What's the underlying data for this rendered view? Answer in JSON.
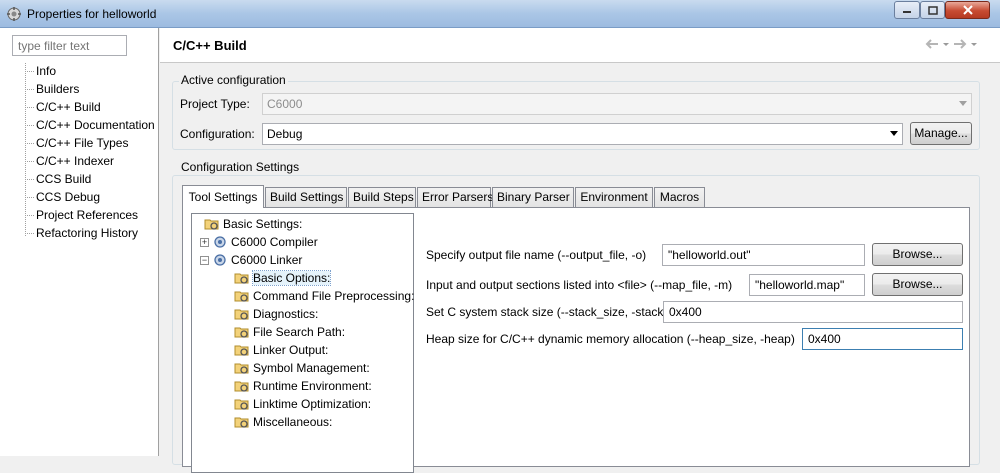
{
  "window": {
    "title": "Properties for helloworld"
  },
  "sidebar": {
    "filter_placeholder": "type filter text",
    "items": [
      {
        "label": "Info"
      },
      {
        "label": "Builders"
      },
      {
        "label": "C/C++ Build"
      },
      {
        "label": "C/C++ Documentation"
      },
      {
        "label": "C/C++ File Types"
      },
      {
        "label": "C/C++ Indexer"
      },
      {
        "label": "CCS Build"
      },
      {
        "label": "CCS Debug"
      },
      {
        "label": "Project References"
      },
      {
        "label": "Refactoring History"
      }
    ],
    "selected_index": 2
  },
  "header": {
    "title": "C/C++ Build",
    "back_icon": "back-arrow-icon",
    "forward_icon": "forward-arrow-icon"
  },
  "active_configuration": {
    "legend": "Active configuration",
    "project_type_label": "Project Type:",
    "project_type_value": "C6000",
    "configuration_label": "Configuration:",
    "configuration_value": "Debug",
    "manage_button": "Manage..."
  },
  "configuration_settings": {
    "legend": "Configuration Settings",
    "tabs": [
      {
        "label": "Tool Settings"
      },
      {
        "label": "Build Settings"
      },
      {
        "label": "Build Steps"
      },
      {
        "label": "Error Parsers"
      },
      {
        "label": "Binary Parser"
      },
      {
        "label": "Environment"
      },
      {
        "label": "Macros"
      }
    ],
    "active_tab_index": 0
  },
  "tool_tree": {
    "items": [
      {
        "label": "Basic Settings:",
        "icon": "settings-folder-icon"
      },
      {
        "label": "C6000 Compiler",
        "icon": "tool-gear-icon"
      },
      {
        "label": "C6000 Linker",
        "icon": "tool-gear-icon"
      },
      {
        "label": "Basic Options:",
        "icon": "settings-folder-icon"
      },
      {
        "label": "Command File Preprocessing:",
        "icon": "settings-folder-icon"
      },
      {
        "label": "Diagnostics:",
        "icon": "settings-folder-icon"
      },
      {
        "label": "File Search Path:",
        "icon": "settings-folder-icon"
      },
      {
        "label": "Linker Output:",
        "icon": "settings-folder-icon"
      },
      {
        "label": "Symbol Management:",
        "icon": "settings-folder-icon"
      },
      {
        "label": "Runtime Environment:",
        "icon": "settings-folder-icon"
      },
      {
        "label": "Linktime Optimization:",
        "icon": "settings-folder-icon"
      },
      {
        "label": "Miscellaneous:",
        "icon": "settings-folder-icon"
      }
    ],
    "selected_index": 3
  },
  "options": {
    "output_file_label": "Specify output file name (--output_file, -o)",
    "output_file_value": "\"helloworld.out\"",
    "map_file_label": "Input and output sections listed into <file> (--map_file, -m)",
    "map_file_value": "\"helloworld.map\"",
    "stack_size_label": "Set C system stack size (--stack_size, -stack)",
    "stack_size_value": "0x400",
    "heap_size_label": "Heap size for C/C++ dynamic memory allocation (--heap_size, -heap)",
    "heap_size_value": "0x400",
    "browse_label": "Browse..."
  }
}
